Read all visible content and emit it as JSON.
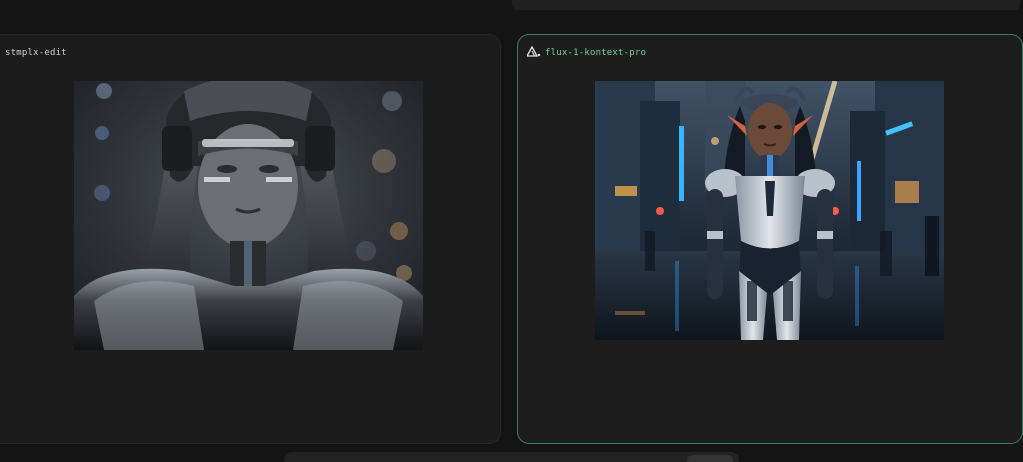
{
  "panels": [
    {
      "model_label": "stmplx-edit",
      "image_alt": "Grayscale portrait of a woman in a sleek black robotic helmet and armor with a blurred city background"
    },
    {
      "model_label": "flux-1-kontext-pro",
      "image_alt": "Elf-eared woman in a white and blue armored suit standing on a rainy neon-lit city street",
      "selected": true
    }
  ],
  "colors": {
    "selected_border": "#3f7a63",
    "selected_label": "#6fd39f",
    "panel_bg": "#1c1c1c",
    "page_bg": "#141414"
  },
  "icons": {
    "model_logo": "triangle-logo-icon"
  }
}
